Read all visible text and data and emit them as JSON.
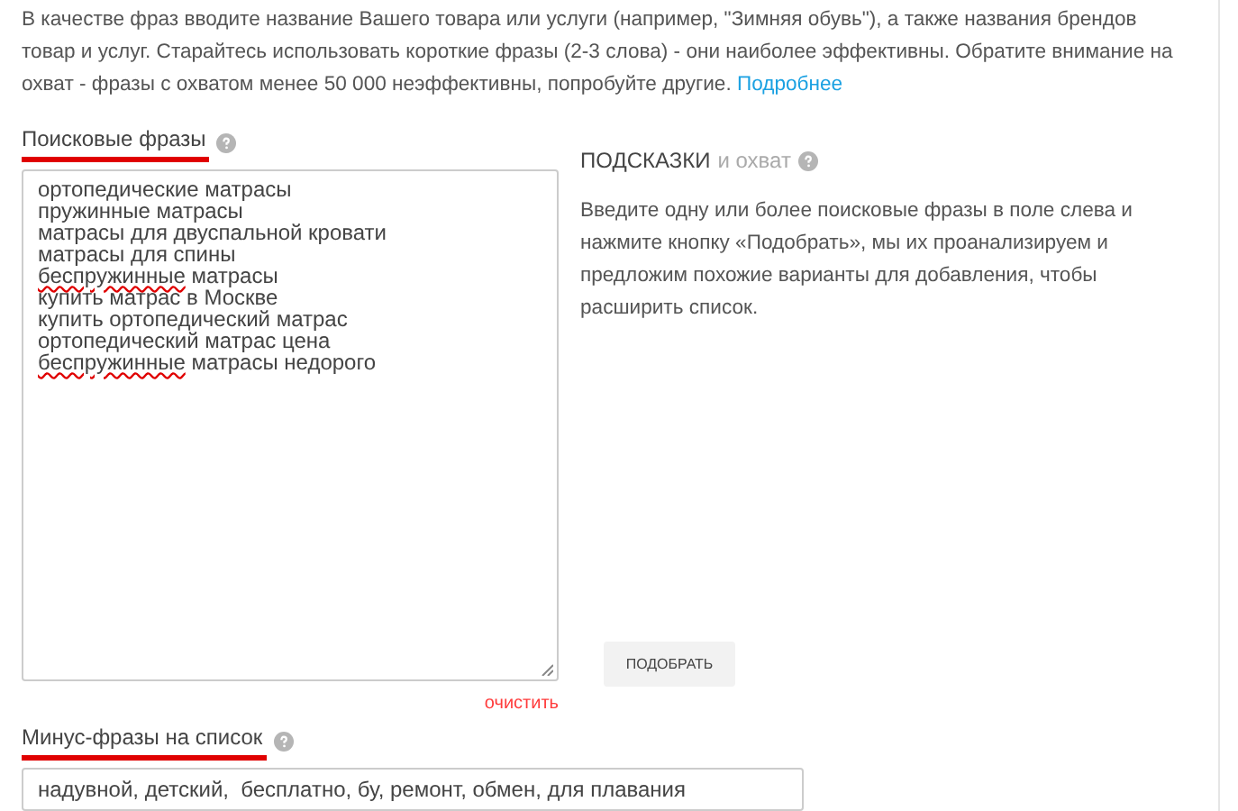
{
  "intro": {
    "text": "В качестве фраз вводите название Вашего товара или услуги (например, \"Зимняя обувь\"), а также названия брендов товар и услуг. Старайтесь использовать короткие фразы (2-3 слова) - они наиболее эффективны. Обратите внимание на охват - фразы с охватом менее 50 000 неэффективны, попробуйте другие.",
    "link": "Подробнее"
  },
  "phrases": {
    "label": "Поисковые фразы",
    "lines": [
      {
        "text": "ортопедические матрасы"
      },
      {
        "text": "пружинные матрасы"
      },
      {
        "text": "матрасы для двуспальной кровати"
      },
      {
        "text": "матрасы для спины"
      },
      {
        "text": " матрасы",
        "misspelled": "беспружинные"
      },
      {
        "text": "купить матрас в Москве"
      },
      {
        "text": "купить ортопедический матрас"
      },
      {
        "text": "ортопедический матрас цена"
      },
      {
        "text": " матрасы недорого",
        "misspelled": "беспружинные"
      }
    ],
    "clear": "очистить"
  },
  "hints": {
    "title": "ПОДСКАЗКИ",
    "subtitle": "и охват",
    "text": "Введите одну или более поисковые фразы в поле слева и нажмите кнопку «Подобрать», мы их проанализируем и предложим похожие варианты для добавления, чтобы расширить список.",
    "button": "ПОДОБРАТЬ"
  },
  "minus": {
    "label": "Минус-фразы на список",
    "value": "надувной, детский,  бесплатно, бу, ремонт, обмен, для плавания"
  }
}
